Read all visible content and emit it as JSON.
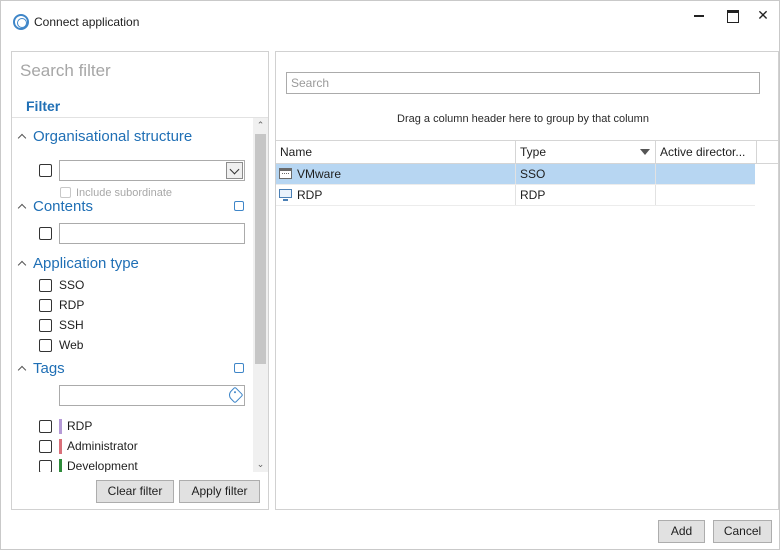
{
  "window": {
    "title": "Connect application",
    "minimize_icon": "minimize-icon",
    "maximize_icon": "maximize-icon",
    "close_glyph": "✕"
  },
  "filter_panel": {
    "search_placeholder": "Search filter",
    "heading": "Filter",
    "sections": {
      "org_structure": {
        "title": "Organisational structure",
        "combo_value": "",
        "include_subordinate_label": "Include subordinate",
        "include_subordinate_checked": false
      },
      "contents": {
        "title": "Contents",
        "value": ""
      },
      "application_type": {
        "title": "Application type",
        "options": [
          {
            "label": "SSO",
            "checked": false
          },
          {
            "label": "RDP",
            "checked": false
          },
          {
            "label": "SSH",
            "checked": false
          },
          {
            "label": "Web",
            "checked": false
          }
        ]
      },
      "tags": {
        "title": "Tags",
        "search_value": "",
        "items": [
          {
            "label": "RDP",
            "color": "#b59ad6",
            "checked": false
          },
          {
            "label": "Administrator",
            "color": "#d9707a",
            "checked": false
          },
          {
            "label": "Development",
            "color": "#2e8b3a",
            "checked": false
          }
        ]
      }
    },
    "clear_button": "Clear filter",
    "apply_button": "Apply filter"
  },
  "app_grid": {
    "search_placeholder": "Search",
    "group_hint": "Drag a column header here to group by that column",
    "columns": [
      "Name",
      "Type",
      "Active director..."
    ],
    "rows": [
      {
        "name": "VMware",
        "type": "SSO",
        "active_directory": "",
        "icon": "vm-icon",
        "selected": true
      },
      {
        "name": "RDP",
        "type": "RDP",
        "active_directory": "",
        "icon": "monitor-icon",
        "selected": false
      }
    ]
  },
  "footer": {
    "add_button": "Add",
    "cancel_button": "Cancel"
  },
  "colors": {
    "accent": "#1f6fb5",
    "selection": "#b7d6f2"
  }
}
